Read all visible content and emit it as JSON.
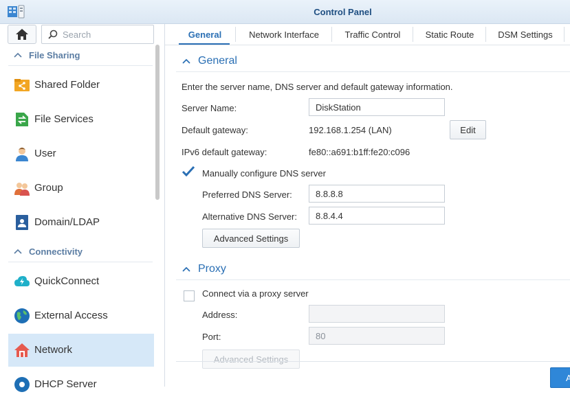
{
  "window": {
    "title": "Control Panel"
  },
  "sidebar": {
    "search_placeholder": "Search",
    "sections": [
      {
        "label": "File Sharing",
        "items": [
          {
            "label": "Shared Folder",
            "icon": "shared-folder-icon"
          },
          {
            "label": "File Services",
            "icon": "file-services-icon"
          },
          {
            "label": "User",
            "icon": "user-icon"
          },
          {
            "label": "Group",
            "icon": "group-icon"
          },
          {
            "label": "Domain/LDAP",
            "icon": "domain-ldap-icon"
          }
        ]
      },
      {
        "label": "Connectivity",
        "items": [
          {
            "label": "QuickConnect",
            "icon": "quickconnect-icon"
          },
          {
            "label": "External Access",
            "icon": "external-access-icon"
          },
          {
            "label": "Network",
            "icon": "network-icon",
            "active": true
          },
          {
            "label": "DHCP Server",
            "icon": "dhcp-server-icon"
          }
        ]
      }
    ]
  },
  "tabs": [
    {
      "label": "General",
      "active": true
    },
    {
      "label": "Network Interface"
    },
    {
      "label": "Traffic Control"
    },
    {
      "label": "Static Route"
    },
    {
      "label": "DSM Settings"
    }
  ],
  "general": {
    "heading": "General",
    "description": "Enter the server name, DNS server and default gateway information.",
    "server_name_label": "Server Name:",
    "server_name_value": "DiskStation",
    "default_gateway_label": "Default gateway:",
    "default_gateway_value": "192.168.1.254 (LAN)",
    "edit_label": "Edit",
    "ipv6_gateway_label": "IPv6 default gateway:",
    "ipv6_gateway_value": "fe80::a691:b1ff:fe20:c096",
    "manual_dns_label": "Manually configure DNS server",
    "manual_dns_checked": true,
    "preferred_dns_label": "Preferred DNS Server:",
    "preferred_dns_value": "8.8.8.8",
    "alternative_dns_label": "Alternative DNS Server:",
    "alternative_dns_value": "8.8.4.4",
    "advanced_settings_label": "Advanced Settings"
  },
  "proxy": {
    "heading": "Proxy",
    "connect_label": "Connect via a proxy server",
    "connect_checked": false,
    "address_label": "Address:",
    "address_value": "",
    "port_label": "Port:",
    "port_value": "80",
    "advanced_settings_label": "Advanced Settings"
  },
  "footer": {
    "apply_label": "A"
  },
  "colors": {
    "accent": "#2a6fb4",
    "active_nav": "#d6e8f8",
    "apply": "#2f87d8"
  }
}
